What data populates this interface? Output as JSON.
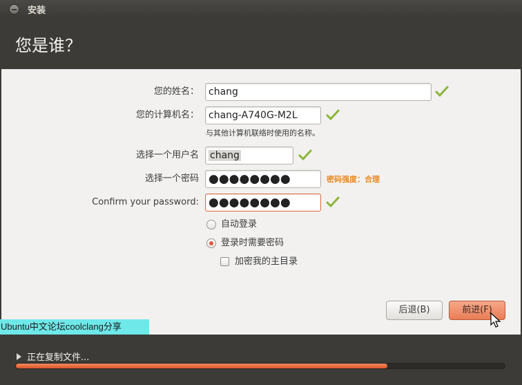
{
  "window": {
    "title": "安装"
  },
  "page": {
    "heading": "您是谁？"
  },
  "form": {
    "name": {
      "label": "您的姓名：",
      "value": "chang"
    },
    "computer": {
      "label": "您的计算机名：",
      "value": "chang-A740G-M2L",
      "hint": "与其他计算机联络时使用的名称。"
    },
    "username": {
      "label": "选择一个用户名",
      "value": "chang"
    },
    "password": {
      "label": "选择一个密码",
      "value": "●●●●●●●●",
      "strength": "密码强度：合理"
    },
    "confirm": {
      "label": "Confirm your password:",
      "value": "●●●●●●●●"
    },
    "options": {
      "autologin": {
        "label": "自动登录",
        "selected": false
      },
      "require_password": {
        "label": "登录时需要密码",
        "selected": true
      },
      "encrypt_home": {
        "label": "加密我的主目录",
        "checked": false
      }
    }
  },
  "buttons": {
    "back": "后退(B)",
    "forward": "前进(F)"
  },
  "watermark": "Ubuntu中文论坛coolclang分享",
  "status": {
    "text": "正在复制文件...",
    "progress": 0.76
  },
  "colors": {
    "accent": "#e97d56",
    "check": "#7aa82a",
    "strength": "#e8891f"
  }
}
